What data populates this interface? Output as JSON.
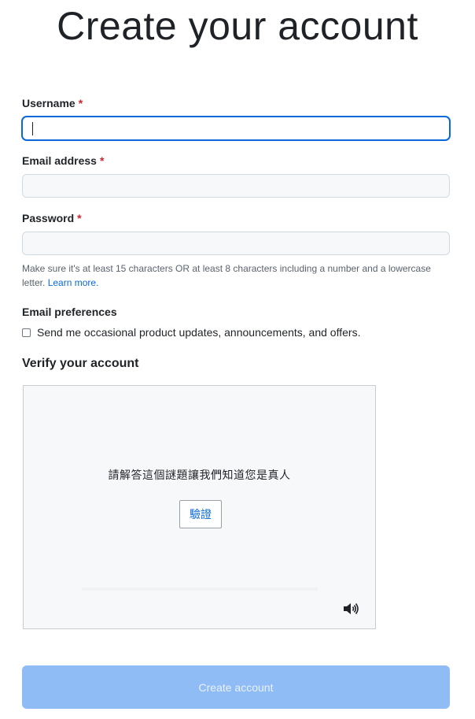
{
  "page": {
    "title": "Create your account"
  },
  "form": {
    "username": {
      "label": "Username",
      "required_mark": "*",
      "value": ""
    },
    "email": {
      "label": "Email address",
      "required_mark": "*",
      "value": ""
    },
    "password": {
      "label": "Password",
      "required_mark": "*",
      "value": "",
      "hint": "Make sure it's at least 15 characters OR at least 8 characters including a number and a lowercase letter.",
      "hint_link": "Learn more."
    },
    "email_preferences": {
      "label": "Email preferences",
      "checkbox_label": "Send me occasional product updates, announcements, and offers.",
      "checked": false
    }
  },
  "verify": {
    "title": "Verify your account",
    "prompt": "請解答這個謎題讓我們知道您是真人",
    "button": "驗證",
    "audio_icon": "speaker-icon"
  },
  "submit": {
    "label": "Create account",
    "disabled": true
  },
  "colors": {
    "accent": "#0969da",
    "required": "#d1242f",
    "submit_disabled_bg": "#8fbcf5"
  }
}
